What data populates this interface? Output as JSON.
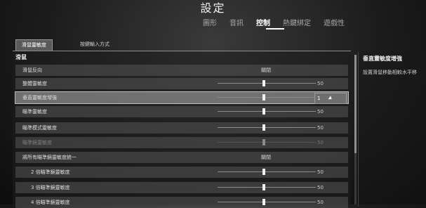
{
  "page_title": "設定",
  "main_tabs": [
    {
      "label": "圖形",
      "active": false
    },
    {
      "label": "音訊",
      "active": false
    },
    {
      "label": "控制",
      "active": true
    },
    {
      "label": "熱鍵綁定",
      "active": false
    },
    {
      "label": "遊戲性",
      "active": false
    }
  ],
  "sub_tabs": [
    {
      "label": "滑鼠靈敏度",
      "active": true
    },
    {
      "label": "按鍵輸入方式",
      "active": false
    }
  ],
  "section": {
    "label": "滑鼠"
  },
  "rows": [
    {
      "label": "滑鼠反向",
      "type": "toggle",
      "value": "關閉"
    },
    {
      "label": "整體靈敏度",
      "type": "slider",
      "value": "50",
      "level": 0.5
    },
    {
      "label": "垂直靈敏度增強",
      "type": "slider",
      "value": "1",
      "level": 0.5,
      "highlighted": true
    },
    {
      "label": "瞄準靈敏度",
      "type": "slider",
      "value": "50",
      "level": 0.5
    },
    {
      "label": "瞄準模式靈敏度",
      "type": "slider",
      "value": "50",
      "level": 0.5
    },
    {
      "label": "瞄準鏡靈敏度",
      "type": "slider",
      "value": "50",
      "level": 0.5,
      "disabled": true
    },
    {
      "label": "將所有瞄準鏡靈敏度統一",
      "type": "toggle",
      "value": "關閉"
    },
    {
      "label": "2 倍瞄準鏡靈敏度",
      "type": "slider",
      "value": "50",
      "level": 0.5,
      "indent": true
    },
    {
      "label": "3 倍瞄準鏡靈敏度",
      "type": "slider",
      "value": "50",
      "level": 0.5,
      "indent": true
    },
    {
      "label": "4 倍瞄準鏡靈敏度",
      "type": "slider",
      "value": "50",
      "level": 0.5,
      "indent": true
    }
  ],
  "description": {
    "title": "垂直靈敏度增強",
    "text": "設置滑鼠移動相較水平移"
  },
  "colors": {
    "accent": "#ffffff",
    "row_bg": "#555555",
    "row_highlight": "#8c8c8c"
  }
}
